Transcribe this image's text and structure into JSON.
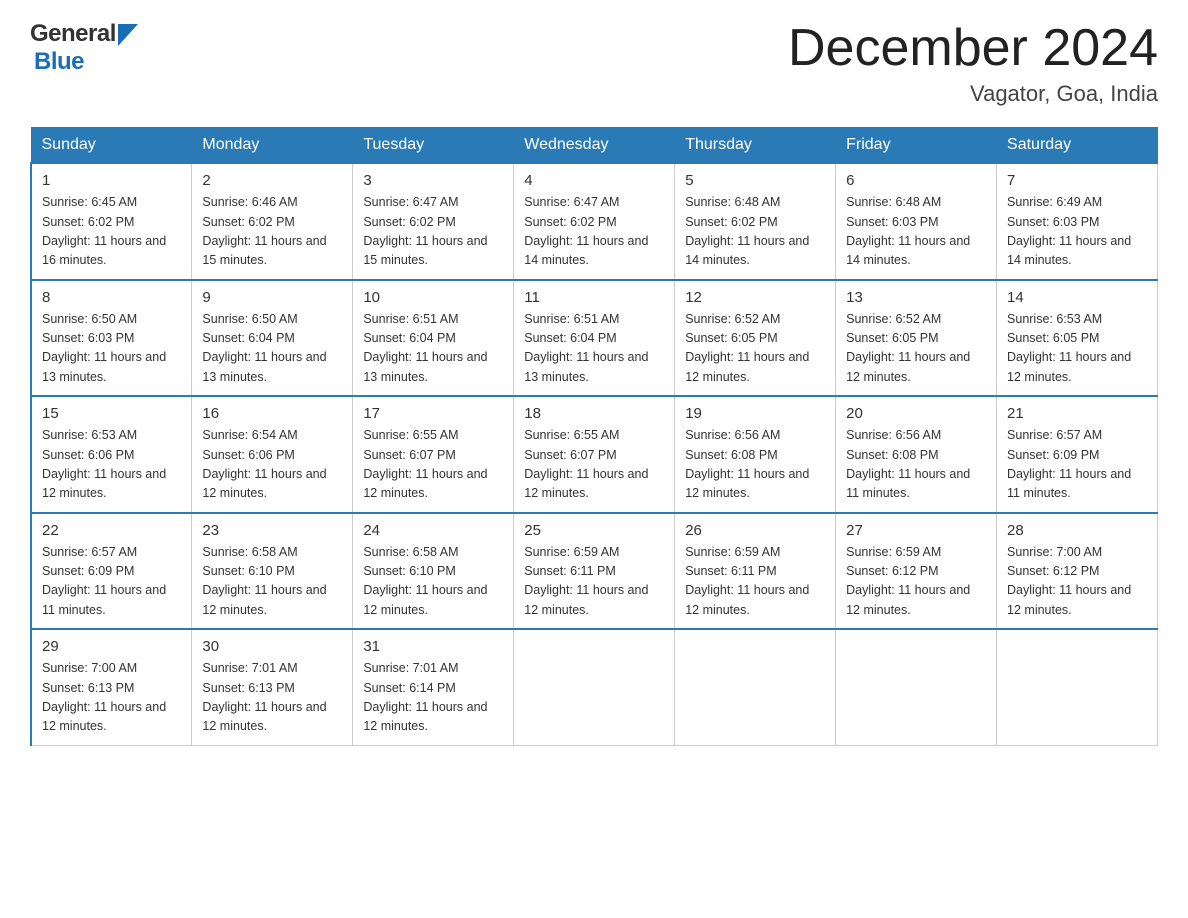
{
  "header": {
    "logo_general": "General",
    "logo_blue": "Blue",
    "title": "December 2024",
    "subtitle": "Vagator, Goa, India"
  },
  "weekdays": [
    "Sunday",
    "Monday",
    "Tuesday",
    "Wednesday",
    "Thursday",
    "Friday",
    "Saturday"
  ],
  "weeks": [
    [
      {
        "day": "1",
        "sunrise": "6:45 AM",
        "sunset": "6:02 PM",
        "daylight": "11 hours and 16 minutes."
      },
      {
        "day": "2",
        "sunrise": "6:46 AM",
        "sunset": "6:02 PM",
        "daylight": "11 hours and 15 minutes."
      },
      {
        "day": "3",
        "sunrise": "6:47 AM",
        "sunset": "6:02 PM",
        "daylight": "11 hours and 15 minutes."
      },
      {
        "day": "4",
        "sunrise": "6:47 AM",
        "sunset": "6:02 PM",
        "daylight": "11 hours and 14 minutes."
      },
      {
        "day": "5",
        "sunrise": "6:48 AM",
        "sunset": "6:02 PM",
        "daylight": "11 hours and 14 minutes."
      },
      {
        "day": "6",
        "sunrise": "6:48 AM",
        "sunset": "6:03 PM",
        "daylight": "11 hours and 14 minutes."
      },
      {
        "day": "7",
        "sunrise": "6:49 AM",
        "sunset": "6:03 PM",
        "daylight": "11 hours and 14 minutes."
      }
    ],
    [
      {
        "day": "8",
        "sunrise": "6:50 AM",
        "sunset": "6:03 PM",
        "daylight": "11 hours and 13 minutes."
      },
      {
        "day": "9",
        "sunrise": "6:50 AM",
        "sunset": "6:04 PM",
        "daylight": "11 hours and 13 minutes."
      },
      {
        "day": "10",
        "sunrise": "6:51 AM",
        "sunset": "6:04 PM",
        "daylight": "11 hours and 13 minutes."
      },
      {
        "day": "11",
        "sunrise": "6:51 AM",
        "sunset": "6:04 PM",
        "daylight": "11 hours and 13 minutes."
      },
      {
        "day": "12",
        "sunrise": "6:52 AM",
        "sunset": "6:05 PM",
        "daylight": "11 hours and 12 minutes."
      },
      {
        "day": "13",
        "sunrise": "6:52 AM",
        "sunset": "6:05 PM",
        "daylight": "11 hours and 12 minutes."
      },
      {
        "day": "14",
        "sunrise": "6:53 AM",
        "sunset": "6:05 PM",
        "daylight": "11 hours and 12 minutes."
      }
    ],
    [
      {
        "day": "15",
        "sunrise": "6:53 AM",
        "sunset": "6:06 PM",
        "daylight": "11 hours and 12 minutes."
      },
      {
        "day": "16",
        "sunrise": "6:54 AM",
        "sunset": "6:06 PM",
        "daylight": "11 hours and 12 minutes."
      },
      {
        "day": "17",
        "sunrise": "6:55 AM",
        "sunset": "6:07 PM",
        "daylight": "11 hours and 12 minutes."
      },
      {
        "day": "18",
        "sunrise": "6:55 AM",
        "sunset": "6:07 PM",
        "daylight": "11 hours and 12 minutes."
      },
      {
        "day": "19",
        "sunrise": "6:56 AM",
        "sunset": "6:08 PM",
        "daylight": "11 hours and 12 minutes."
      },
      {
        "day": "20",
        "sunrise": "6:56 AM",
        "sunset": "6:08 PM",
        "daylight": "11 hours and 11 minutes."
      },
      {
        "day": "21",
        "sunrise": "6:57 AM",
        "sunset": "6:09 PM",
        "daylight": "11 hours and 11 minutes."
      }
    ],
    [
      {
        "day": "22",
        "sunrise": "6:57 AM",
        "sunset": "6:09 PM",
        "daylight": "11 hours and 11 minutes."
      },
      {
        "day": "23",
        "sunrise": "6:58 AM",
        "sunset": "6:10 PM",
        "daylight": "11 hours and 12 minutes."
      },
      {
        "day": "24",
        "sunrise": "6:58 AM",
        "sunset": "6:10 PM",
        "daylight": "11 hours and 12 minutes."
      },
      {
        "day": "25",
        "sunrise": "6:59 AM",
        "sunset": "6:11 PM",
        "daylight": "11 hours and 12 minutes."
      },
      {
        "day": "26",
        "sunrise": "6:59 AM",
        "sunset": "6:11 PM",
        "daylight": "11 hours and 12 minutes."
      },
      {
        "day": "27",
        "sunrise": "6:59 AM",
        "sunset": "6:12 PM",
        "daylight": "11 hours and 12 minutes."
      },
      {
        "day": "28",
        "sunrise": "7:00 AM",
        "sunset": "6:12 PM",
        "daylight": "11 hours and 12 minutes."
      }
    ],
    [
      {
        "day": "29",
        "sunrise": "7:00 AM",
        "sunset": "6:13 PM",
        "daylight": "11 hours and 12 minutes."
      },
      {
        "day": "30",
        "sunrise": "7:01 AM",
        "sunset": "6:13 PM",
        "daylight": "11 hours and 12 minutes."
      },
      {
        "day": "31",
        "sunrise": "7:01 AM",
        "sunset": "6:14 PM",
        "daylight": "11 hours and 12 minutes."
      },
      null,
      null,
      null,
      null
    ]
  ]
}
